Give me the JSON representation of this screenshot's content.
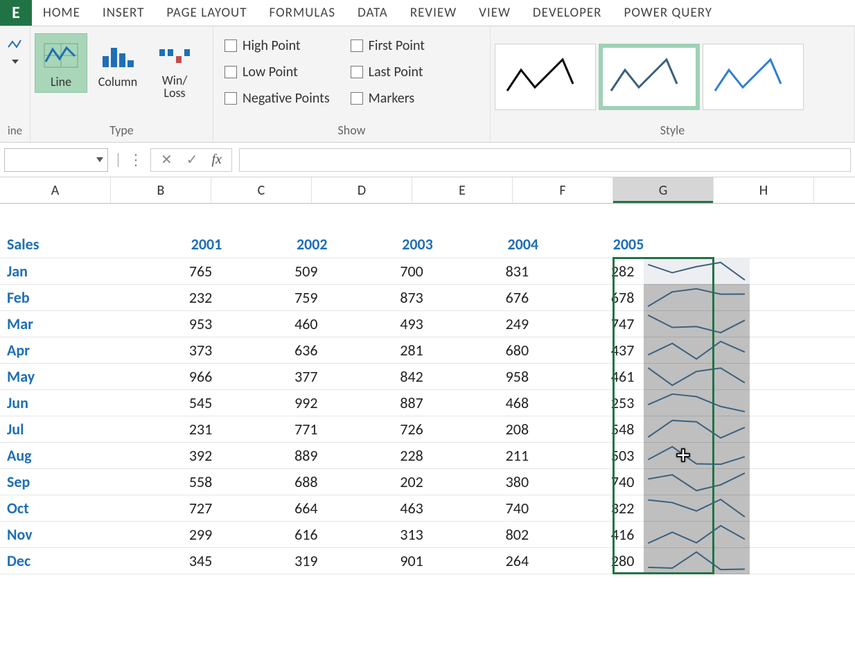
{
  "ribbon": {
    "tabs": [
      "HOME",
      "INSERT",
      "PAGE LAYOUT",
      "FORMULAS",
      "DATA",
      "REVIEW",
      "VIEW",
      "DEVELOPER",
      "POWER QUERY"
    ],
    "left_fragment_label": "ine",
    "type_group": {
      "label": "Type",
      "buttons": {
        "line": "Line",
        "column": "Column",
        "winloss_l1": "Win/",
        "winloss_l2": "Loss"
      },
      "active": "line"
    },
    "show_group": {
      "label": "Show",
      "items": {
        "high": "High Point",
        "low": "Low Point",
        "neg": "Negative Points",
        "first": "First Point",
        "last": "Last Point",
        "markers": "Markers"
      }
    },
    "style_group": {
      "label": "Style"
    }
  },
  "formula_bar": {
    "fx": "fx"
  },
  "columns": [
    "A",
    "B",
    "C",
    "D",
    "E",
    "F",
    "G",
    "H"
  ],
  "selected_column_index": 6,
  "table": {
    "corner": "Sales",
    "years": [
      "2001",
      "2002",
      "2003",
      "2004",
      "2005"
    ],
    "rows": [
      {
        "m": "Jan",
        "v": [
          765,
          509,
          700,
          831,
          282
        ]
      },
      {
        "m": "Feb",
        "v": [
          232,
          759,
          873,
          676,
          678
        ]
      },
      {
        "m": "Mar",
        "v": [
          953,
          460,
          493,
          249,
          747
        ]
      },
      {
        "m": "Apr",
        "v": [
          373,
          636,
          281,
          680,
          437
        ]
      },
      {
        "m": "May",
        "v": [
          966,
          377,
          842,
          958,
          461
        ]
      },
      {
        "m": "Jun",
        "v": [
          545,
          992,
          887,
          468,
          253
        ]
      },
      {
        "m": "Jul",
        "v": [
          231,
          771,
          726,
          208,
          548
        ]
      },
      {
        "m": "Aug",
        "v": [
          392,
          889,
          228,
          211,
          503
        ]
      },
      {
        "m": "Sep",
        "v": [
          558,
          688,
          202,
          380,
          740
        ]
      },
      {
        "m": "Oct",
        "v": [
          727,
          664,
          463,
          740,
          322
        ]
      },
      {
        "m": "Nov",
        "v": [
          299,
          616,
          313,
          802,
          416
        ]
      },
      {
        "m": "Dec",
        "v": [
          345,
          319,
          901,
          264,
          280
        ]
      }
    ]
  },
  "chart_data": {
    "type": "line",
    "description": "Sparklines per month across years 2001–2005",
    "x": [
      "2001",
      "2002",
      "2003",
      "2004",
      "2005"
    ],
    "series": [
      {
        "name": "Jan",
        "values": [
          765,
          509,
          700,
          831,
          282
        ]
      },
      {
        "name": "Feb",
        "values": [
          232,
          759,
          873,
          676,
          678
        ]
      },
      {
        "name": "Mar",
        "values": [
          953,
          460,
          493,
          249,
          747
        ]
      },
      {
        "name": "Apr",
        "values": [
          373,
          636,
          281,
          680,
          437
        ]
      },
      {
        "name": "May",
        "values": [
          966,
          377,
          842,
          958,
          461
        ]
      },
      {
        "name": "Jun",
        "values": [
          545,
          992,
          887,
          468,
          253
        ]
      },
      {
        "name": "Jul",
        "values": [
          231,
          771,
          726,
          208,
          548
        ]
      },
      {
        "name": "Aug",
        "values": [
          392,
          889,
          228,
          211,
          503
        ]
      },
      {
        "name": "Sep",
        "values": [
          558,
          688,
          202,
          380,
          740
        ]
      },
      {
        "name": "Oct",
        "values": [
          727,
          664,
          463,
          740,
          322
        ]
      },
      {
        "name": "Nov",
        "values": [
          299,
          616,
          313,
          802,
          416
        ]
      },
      {
        "name": "Dec",
        "values": [
          345,
          319,
          901,
          264,
          280
        ]
      }
    ]
  }
}
